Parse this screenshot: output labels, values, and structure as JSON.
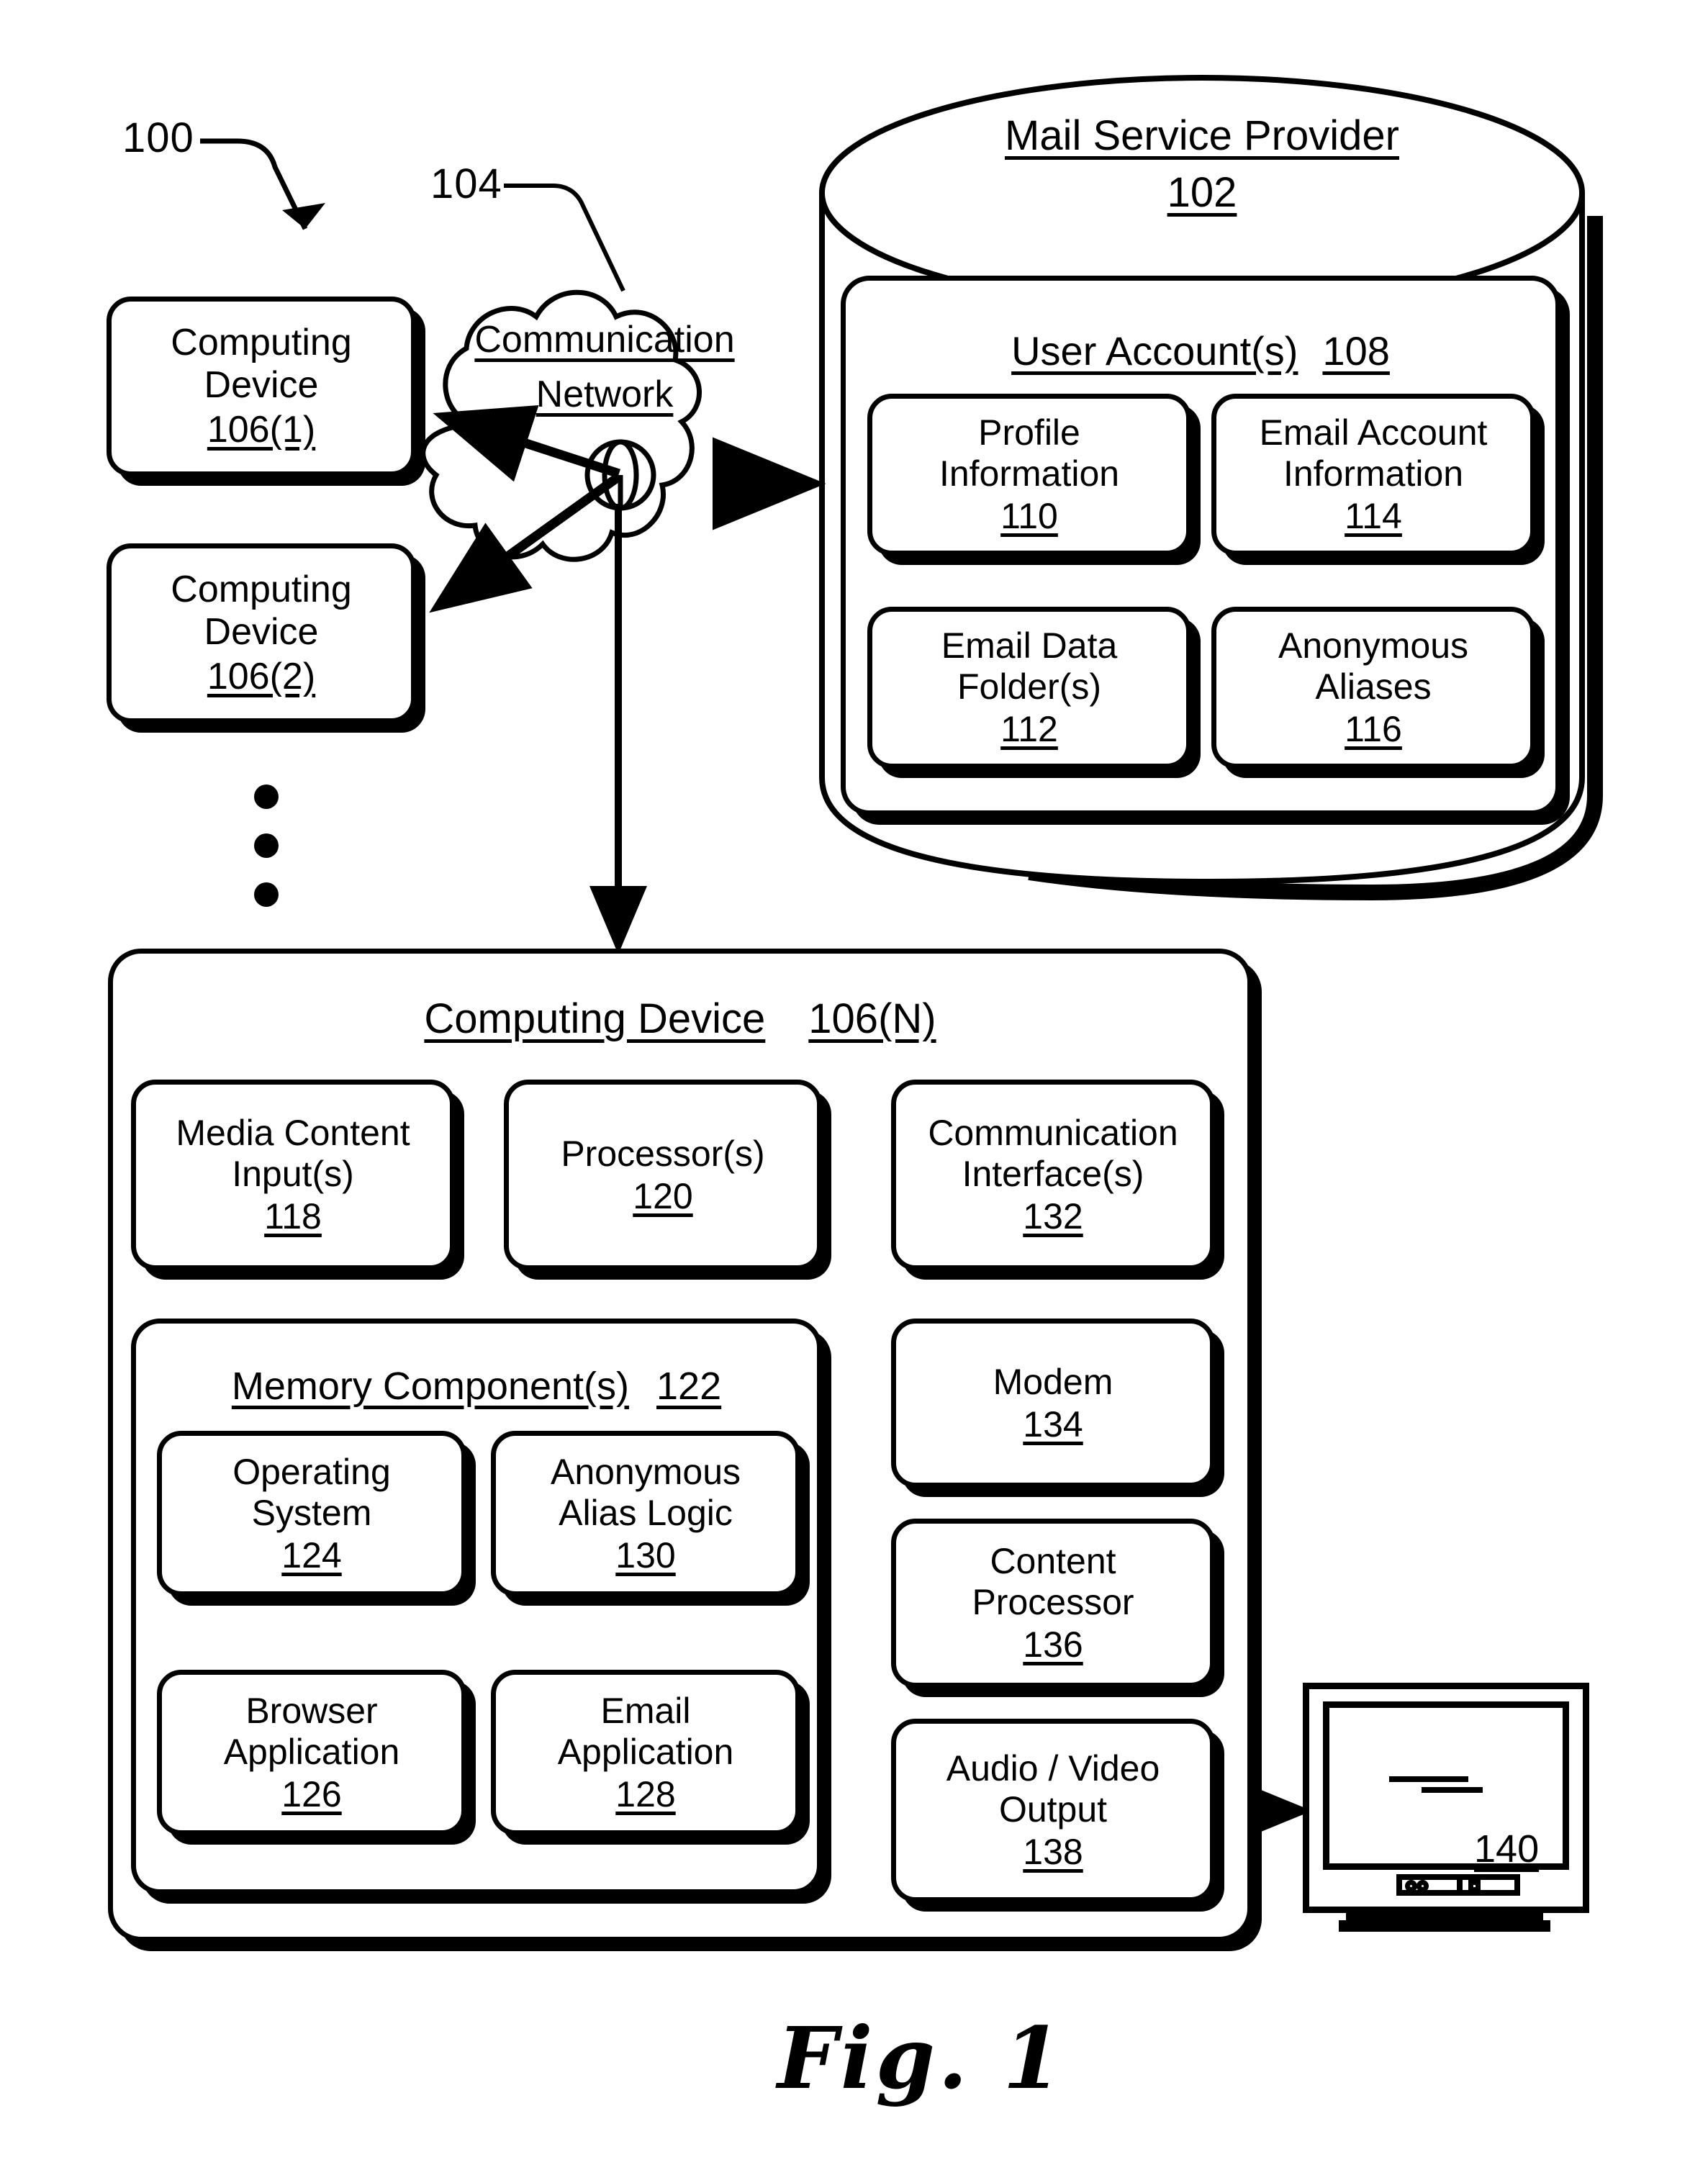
{
  "figure": {
    "caption": "Fig. 1",
    "system_ref": "100",
    "network_ref": "104"
  },
  "mail_service_provider": {
    "title": "Mail Service Provider",
    "ref": "102",
    "user_accounts": {
      "title": "User Account(s)",
      "ref": "108",
      "items": [
        {
          "title": "Profile Information",
          "line1": "Profile",
          "line2": "Information",
          "ref": "110"
        },
        {
          "title": "Email Account Information",
          "line1": "Email Account",
          "line2": "Information",
          "ref": "114"
        },
        {
          "title": "Email Data Folder(s)",
          "line1": "Email Data",
          "line2": "Folder(s)",
          "ref": "112"
        },
        {
          "title": "Anonymous Aliases",
          "line1": "Anonymous",
          "line2": "Aliases",
          "ref": "116"
        }
      ]
    }
  },
  "communication_network": {
    "line1": "Communication",
    "line2": "Network",
    "ref": "104"
  },
  "client_devices": [
    {
      "line1": "Computing",
      "line2": "Device",
      "ref": "106(1)"
    },
    {
      "line1": "Computing",
      "line2": "Device",
      "ref": "106(2)"
    }
  ],
  "ellipsis_dots": 3,
  "computing_device_n": {
    "title": "Computing Device",
    "ref": "106(N)",
    "top_row": [
      {
        "line1": "Media Content",
        "line2": "Input(s)",
        "ref": "118"
      },
      {
        "line1": "Processor(s)",
        "line2": "",
        "ref": "120"
      },
      {
        "line1": "Communication",
        "line2": "Interface(s)",
        "ref": "132"
      }
    ],
    "memory": {
      "title": "Memory Component(s)",
      "ref": "122",
      "items": [
        {
          "line1": "Operating",
          "line2": "System",
          "ref": "124"
        },
        {
          "line1": "Anonymous",
          "line2": "Alias Logic",
          "ref": "130"
        },
        {
          "line1": "Browser",
          "line2": "Application",
          "ref": "126"
        },
        {
          "line1": "Email",
          "line2": "Application",
          "ref": "128"
        }
      ]
    },
    "right_column": [
      {
        "line1": "Modem",
        "line2": "",
        "ref": "134"
      },
      {
        "line1": "Content",
        "line2": "Processor",
        "ref": "136"
      },
      {
        "line1": "Audio / Video",
        "line2": "Output",
        "ref": "138"
      }
    ]
  },
  "display": {
    "ref": "140"
  },
  "colors": {
    "ink": "#000000",
    "paper": "#ffffff"
  }
}
